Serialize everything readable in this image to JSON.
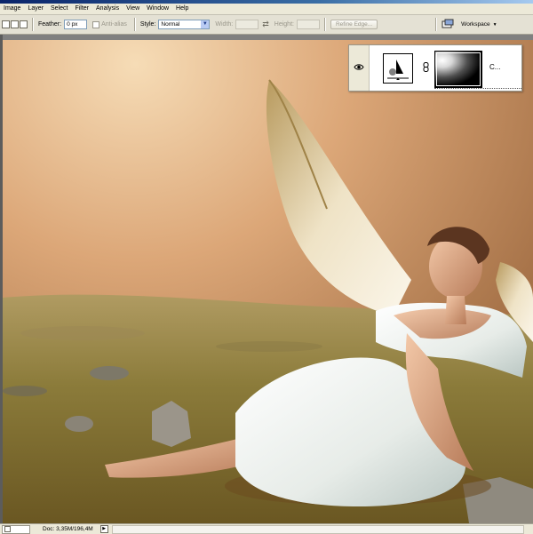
{
  "menubar": {
    "items": [
      "Image",
      "Layer",
      "Select",
      "Filter",
      "Analysis",
      "View",
      "Window",
      "Help"
    ]
  },
  "options": {
    "feather_label": "Feather:",
    "feather_value": "0 px",
    "antialias_label": "Anti-alias",
    "style_label": "Style:",
    "style_value": "Normal",
    "width_label": "Width:",
    "height_label": "Height:",
    "refine_edge_label": "Refine Edge...",
    "workspace_label": "Workspace"
  },
  "layer_panel": {
    "layer_name": "C..."
  },
  "status": {
    "doc_info": "Doc: 3,35M/196,4M"
  },
  "colors": {
    "title_bar": "#0a246a",
    "chrome": "#ece9d8",
    "canvas_bg": "#808080"
  }
}
